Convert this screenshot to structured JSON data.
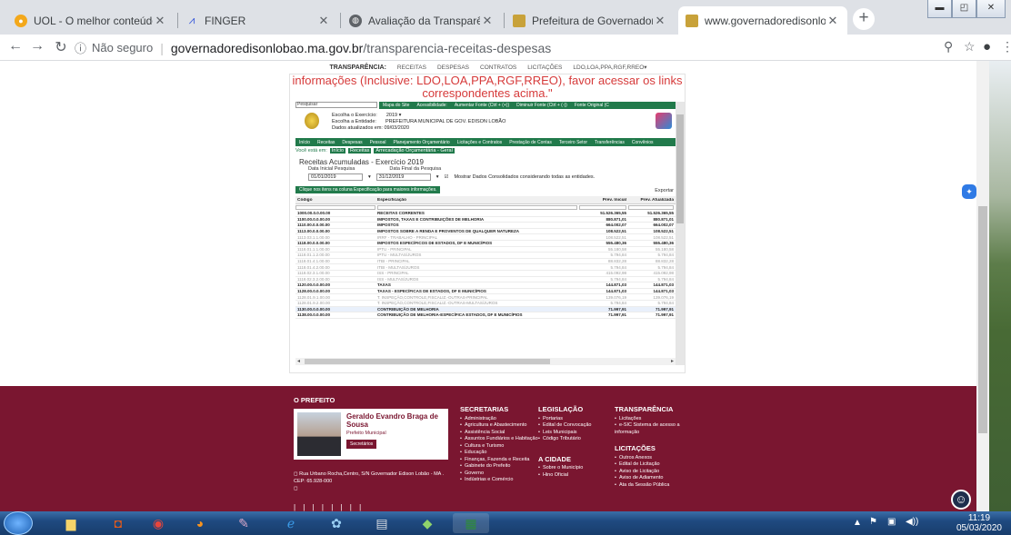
{
  "browser": {
    "tabs": [
      {
        "title": "UOL - O melhor conteúdo",
        "icon": "uol-icon",
        "color": "#f3a81b"
      },
      {
        "title": "FINGER",
        "icon": "finger-icon",
        "color": "#3b5bdb"
      },
      {
        "title": "Avaliação da Transparência dos",
        "icon": "globe-icon",
        "color": "#5f6368"
      },
      {
        "title": "Prefeitura de Governador Ediso",
        "icon": "municipality-icon",
        "color": "#c8a23a"
      },
      {
        "title": "www.governadoredisonlobao.n",
        "icon": "municipality-icon",
        "color": "#c8a23a"
      }
    ],
    "active_tab": 4,
    "address": {
      "security": "Não seguro",
      "host": "governadoredisonlobao.ma.gov.br",
      "path": "/transparencia-receitas-despesas"
    }
  },
  "topnav": {
    "brand": "TRANSPARÊNCIA:",
    "items": [
      "RECEITAS",
      "DESPESAS",
      "CONTRATOS",
      "LICITAÇÕES",
      "LDO,LOA,PPA,RGF,RREO▾"
    ]
  },
  "notice": "informações (Inclusive: LDO,LOA,PPA,RGF,RREO), favor acessar os links correspondentes acima.\"",
  "portal": {
    "search_placeholder": "Pesquisar",
    "header_links": [
      "Mapa do Site",
      "Acessibilidade:",
      "Aumentar Fonte (Ctrl + (+))",
      "Diminuir Fonte (Ctrl + (-))",
      "Fonte Original (C"
    ],
    "exercise_label": "Escolha o Exercício:",
    "exercise_value": "2019",
    "entity_label": "Escolha a Entidade:",
    "entity_value": "PREFEITURA MUNICIPAL DE GOV. EDISON LOBÃO",
    "updated": "Dados atualizados em: 09/03/2020",
    "menu": [
      "Início",
      "Receitas",
      "Despesas",
      "Pessoal",
      "Planejamento Orçamentário",
      "Licitações e Contratos",
      "Prestação de Contas",
      "Terceiro Setor",
      "Transferências",
      "Convênios"
    ],
    "breadcrumb_label": "Você está em:",
    "breadcrumb": [
      "Início",
      "Receitas",
      "Arrecadação Orçamentária - Geral"
    ],
    "title": "Receitas Acumuladas - Exercício 2019",
    "start_label": "Data Inicial Pesquisa",
    "end_label": "Data Final da Pesquisa",
    "start_date": "01/01/2019",
    "end_date": "31/12/2019",
    "consolidated": "Mostrar Dados Consolidados considerando todas as entidades.",
    "click_hint": "Clique nos itens na coluna Especificação para maiores informações.",
    "export": "Exportar",
    "columns": [
      "Código",
      "Especificação",
      "Prev. Inicial",
      "Prev. Atualizada"
    ],
    "rows": [
      {
        "code": "1000.00.0.0.00.00",
        "spec": "RECEITAS CORRENTES",
        "ini": "51.526.365,55",
        "atu": "51.526.365,55",
        "style": "b"
      },
      {
        "code": "1100.00.0.0.00.00",
        "spec": "IMPOSTOS, TAXAS E CONTRIBUIÇÕES DE MELHORIA",
        "ini": "880.871,01",
        "atu": "880.871,01",
        "style": "b"
      },
      {
        "code": "1110.00.0.0.00.00",
        "spec": "IMPOSTOS",
        "ini": "664.002,07",
        "atu": "664.002,07",
        "style": "b"
      },
      {
        "code": "1113.00.0.0.00.00",
        "spec": "IMPOSTOS SOBRE A RENDA E PROVENTOS DE QUALQUER NATUREZA",
        "ini": "108.522,51",
        "atu": "108.522,51",
        "style": "b"
      },
      {
        "code": "1113.03.1.1.00.00",
        "spec": "IRRF - TRABALHO - PRINCIPAL",
        "ini": "108.522,51",
        "atu": "108.522,51",
        "style": "l"
      },
      {
        "code": "1118.00.0.0.00.00",
        "spec": "IMPOSTOS ESPECÍFICOS DE ESTADOS, DF E MUNICÍPIOS",
        "ini": "555.480,36",
        "atu": "555.480,36",
        "style": "b"
      },
      {
        "code": "1118.01.1.1.00.00",
        "spec": "IPTU - PRINCIPAL",
        "ini": "55.180,58",
        "atu": "55.180,58",
        "style": "l"
      },
      {
        "code": "1118.01.1.2.00.00",
        "spec": "IPTU - MULTAS/JUROS",
        "ini": "5.794,84",
        "atu": "5.794,84",
        "style": "l"
      },
      {
        "code": "1118.01.4.1.00.00",
        "spec": "ITBI - PRINCIPAL",
        "ini": "88.832,28",
        "atu": "88.832,28",
        "style": "l"
      },
      {
        "code": "1118.01.4.2.00.00",
        "spec": "ITBI - MULTAS/JUROS",
        "ini": "5.794,84",
        "atu": "5.794,84",
        "style": "l"
      },
      {
        "code": "1118.02.3.1.00.00",
        "spec": "ISS - PRINCIPAL",
        "ini": "415.092,98",
        "atu": "415.092,98",
        "style": "l"
      },
      {
        "code": "1118.02.3.2.00.00",
        "spec": "ISS - MULTAS/JUROS",
        "ini": "5.794,84",
        "atu": "5.794,84",
        "style": "l"
      },
      {
        "code": "1120.00.0.0.00.00",
        "spec": "TAXAS",
        "ini": "144.871,03",
        "atu": "144.871,03",
        "style": "b"
      },
      {
        "code": "1128.00.0.0.00.00",
        "spec": "TAXAS - ESPECÍFICAS DE ESTADOS, DF E MUNICÍPIOS",
        "ini": "144.871,03",
        "atu": "144.871,03",
        "style": "b"
      },
      {
        "code": "1128.01.9.1.00.00",
        "spec": "T. INSPEÇÃO,CONTROLE,FISCALIZ.-OUTRAS-PRINCIPAL",
        "ini": "139.076,19",
        "atu": "139.076,19",
        "style": "l"
      },
      {
        "code": "1128.01.9.2.00.00",
        "spec": "T. INSPEÇÃO,CONTROLE,FISCALIZ.-OUTRAS-MULTAS/JUROS",
        "ini": "5.794,84",
        "atu": "5.794,84",
        "style": "l"
      },
      {
        "code": "1130.00.0.0.00.00",
        "spec": "CONTRIBUIÇÃO DE MELHORIA",
        "ini": "71.997,91",
        "atu": "71.997,91",
        "style": "b sel"
      },
      {
        "code": "1138.00.0.0.00.00",
        "spec": "CONTRIBUIÇÃO DE MELHORIA-ESPECÍFICA ESTADOS, DF E MUNICÍPIOS",
        "ini": "71.997,91",
        "atu": "71.997,91",
        "style": "b"
      }
    ]
  },
  "footer": {
    "prefeito_heading": "O PREFEITO",
    "name": "Geraldo Evandro Braga de Sousa",
    "role": "Prefeito Municipal",
    "role_button": "Secretários",
    "address": "◻ Rua Urbano Rocha,Centro, S/N Governador Edison Lobão - MA . CEP: 65.928-000",
    "extra": "◻",
    "bars": "| | | | | | | |",
    "secretarias_heading": "SECRETARIAS",
    "secretarias": [
      "Administração",
      "Agricultura e Abastecimento",
      "Assistência Social",
      "Assuntos Fundiários e Habitação",
      "Cultura e Turismo",
      "Educação",
      "Finanças, Fazenda e Receita",
      "Gabinete do Prefeito",
      "Governo",
      "Indústrias e Comércio"
    ],
    "legislacao_heading": "LEGISLAÇÃO",
    "legislacao": [
      "Portarias",
      "Edital de Convocação",
      "Leis Municipais",
      "Código Tributário"
    ],
    "cidade_heading": "A CIDADE",
    "cidade": [
      "Sobre o Município",
      "Hino Oficial"
    ],
    "transparencia_heading": "TRANSPARÊNCIA",
    "transparencia": [
      "Licitações",
      "e-SIC Sistema de acesso a informação"
    ],
    "licitacoes_heading": "LICITAÇÕES",
    "licitacoes": [
      "Outros Anexos",
      "Edital de Licitação",
      "Aviso de Licitação",
      "Aviso de Adiamento",
      "Ata da Sessão Pública"
    ]
  },
  "taskbar": {
    "time": "11:19",
    "date": "05/03/2020"
  }
}
